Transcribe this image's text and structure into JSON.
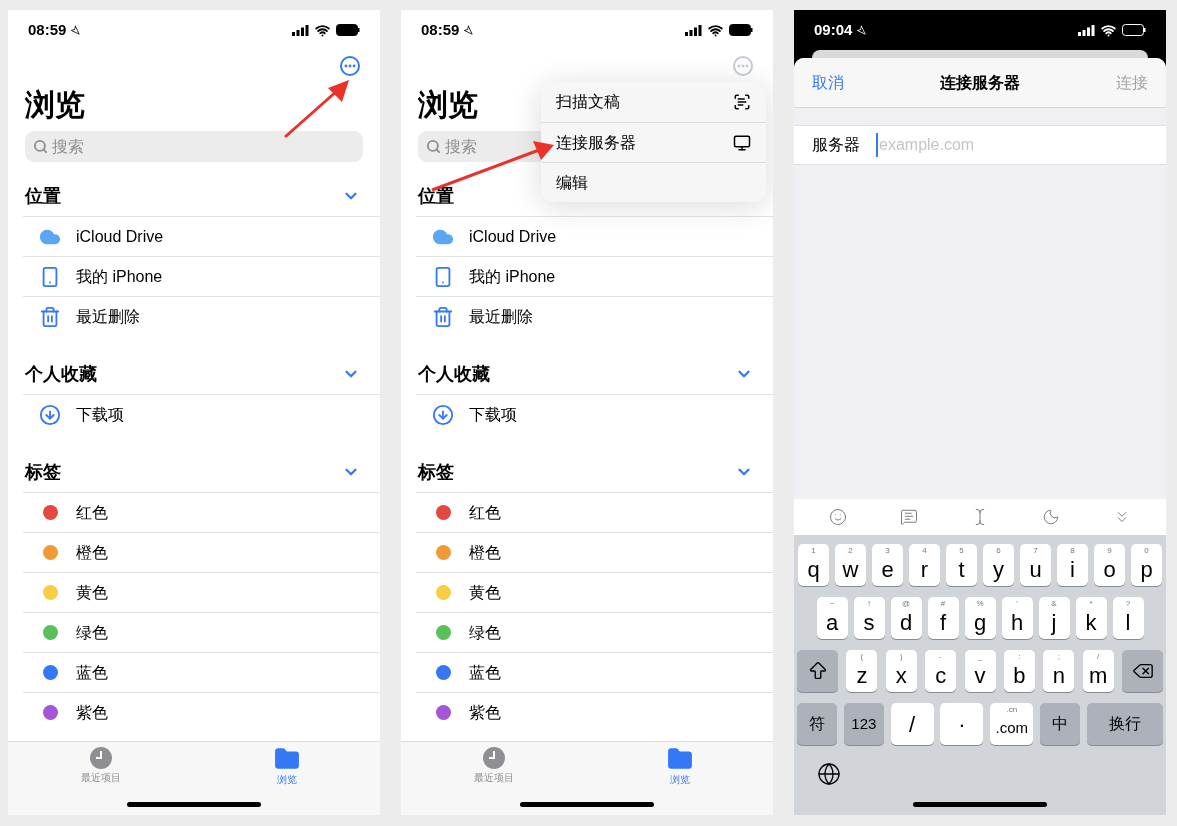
{
  "screens": [
    {
      "status_bar": {
        "time": "08:59"
      },
      "title": "浏览",
      "search": {
        "placeholder": "搜索"
      },
      "arrow": true,
      "sections": [
        {
          "title": "位置",
          "items": [
            {
              "label": "iCloud Drive",
              "kind": "cloud"
            },
            {
              "label": "我的 iPhone",
              "kind": "phone"
            },
            {
              "label": "最近删除",
              "kind": "trash"
            }
          ]
        },
        {
          "title": "个人收藏",
          "items": [
            {
              "label": "下载项",
              "kind": "download"
            }
          ]
        },
        {
          "title": "标签",
          "items": [
            {
              "label": "红色",
              "kind": "tag",
              "color": "#e5483f"
            },
            {
              "label": "橙色",
              "kind": "tag",
              "color": "#f09a37"
            },
            {
              "label": "黄色",
              "kind": "tag",
              "color": "#f7cd46"
            },
            {
              "label": "绿色",
              "kind": "tag",
              "color": "#5ac05a"
            },
            {
              "label": "蓝色",
              "kind": "tag",
              "color": "#3478f6"
            },
            {
              "label": "紫色",
              "kind": "tag",
              "color": "#a455d8"
            }
          ]
        }
      ],
      "tab_bar": [
        {
          "label": "最近项目",
          "kind": "recent",
          "selected": false
        },
        {
          "label": "浏览",
          "kind": "browse",
          "selected": true
        }
      ]
    },
    {
      "status_bar": {
        "time": "08:59"
      },
      "title": "浏览",
      "search": {
        "placeholder": "搜索"
      },
      "arrow": true,
      "menu": [
        {
          "label": "扫描文稿",
          "kind": "scan"
        },
        {
          "label": "连接服务器",
          "kind": "server"
        },
        {
          "label": "编辑",
          "kind": "plain"
        }
      ],
      "sections": [
        {
          "title": "位置",
          "items": [
            {
              "label": "iCloud Drive",
              "kind": "cloud"
            },
            {
              "label": "我的 iPhone",
              "kind": "phone"
            },
            {
              "label": "最近删除",
              "kind": "trash"
            }
          ]
        },
        {
          "title": "个人收藏",
          "items": [
            {
              "label": "下载项",
              "kind": "download"
            }
          ]
        },
        {
          "title": "标签",
          "items": [
            {
              "label": "红色",
              "kind": "tag",
              "color": "#e5483f"
            },
            {
              "label": "橙色",
              "kind": "tag",
              "color": "#f09a37"
            },
            {
              "label": "黄色",
              "kind": "tag",
              "color": "#f7cd46"
            },
            {
              "label": "绿色",
              "kind": "tag",
              "color": "#5ac05a"
            },
            {
              "label": "蓝色",
              "kind": "tag",
              "color": "#3478f6"
            },
            {
              "label": "紫色",
              "kind": "tag",
              "color": "#a455d8"
            }
          ]
        }
      ],
      "tab_bar": [
        {
          "label": "最近项目",
          "kind": "recent",
          "selected": false
        },
        {
          "label": "浏览",
          "kind": "browse",
          "selected": true
        }
      ]
    }
  ],
  "connect_screen": {
    "status_bar": {
      "time": "09:04"
    },
    "nav": {
      "cancel": "取消",
      "title": "连接服务器",
      "connect": "连接",
      "connect_disabled": true
    },
    "field": {
      "label": "服务器",
      "placeholder": "example.com"
    },
    "keyboard": {
      "rows": [
        {
          "keys": [
            {
              "label": "q",
              "hint": "1"
            },
            {
              "label": "w",
              "hint": "2"
            },
            {
              "label": "e",
              "hint": "3"
            },
            {
              "label": "r",
              "hint": "4"
            },
            {
              "label": "t",
              "hint": "5"
            },
            {
              "label": "y",
              "hint": "6"
            },
            {
              "label": "u",
              "hint": "7"
            },
            {
              "label": "i",
              "hint": "8"
            },
            {
              "label": "o",
              "hint": "9"
            },
            {
              "label": "p",
              "hint": "0"
            }
          ]
        },
        {
          "keys": [
            {
              "label": "a",
              "hint": "~"
            },
            {
              "label": "s",
              "hint": "!"
            },
            {
              "label": "d",
              "hint": "@"
            },
            {
              "label": "f",
              "hint": "#"
            },
            {
              "label": "g",
              "hint": "%"
            },
            {
              "label": "h",
              "hint": "'"
            },
            {
              "label": "j",
              "hint": "&"
            },
            {
              "label": "k",
              "hint": "*"
            },
            {
              "label": "l",
              "hint": "?"
            }
          ]
        },
        {
          "keys": [
            {
              "kind": "shift"
            },
            {
              "label": "z",
              "hint": "("
            },
            {
              "label": "x",
              "hint": ")"
            },
            {
              "label": "c",
              "hint": "-"
            },
            {
              "label": "v",
              "hint": "_"
            },
            {
              "label": "b",
              "hint": ":"
            },
            {
              "label": "n",
              "hint": ";"
            },
            {
              "label": "m",
              "hint": "/"
            },
            {
              "kind": "delete"
            }
          ]
        },
        {
          "keys": [
            {
              "label": "符",
              "kind": "function"
            },
            {
              "label": "123",
              "kind": "function"
            },
            {
              "label": "/"
            },
            {
              "label": "·"
            },
            {
              "label": ".com",
              "hint": ".cn"
            },
            {
              "label": "中",
              "kind": "function"
            },
            {
              "label": "换行",
              "kind": "return"
            }
          ]
        }
      ]
    }
  }
}
